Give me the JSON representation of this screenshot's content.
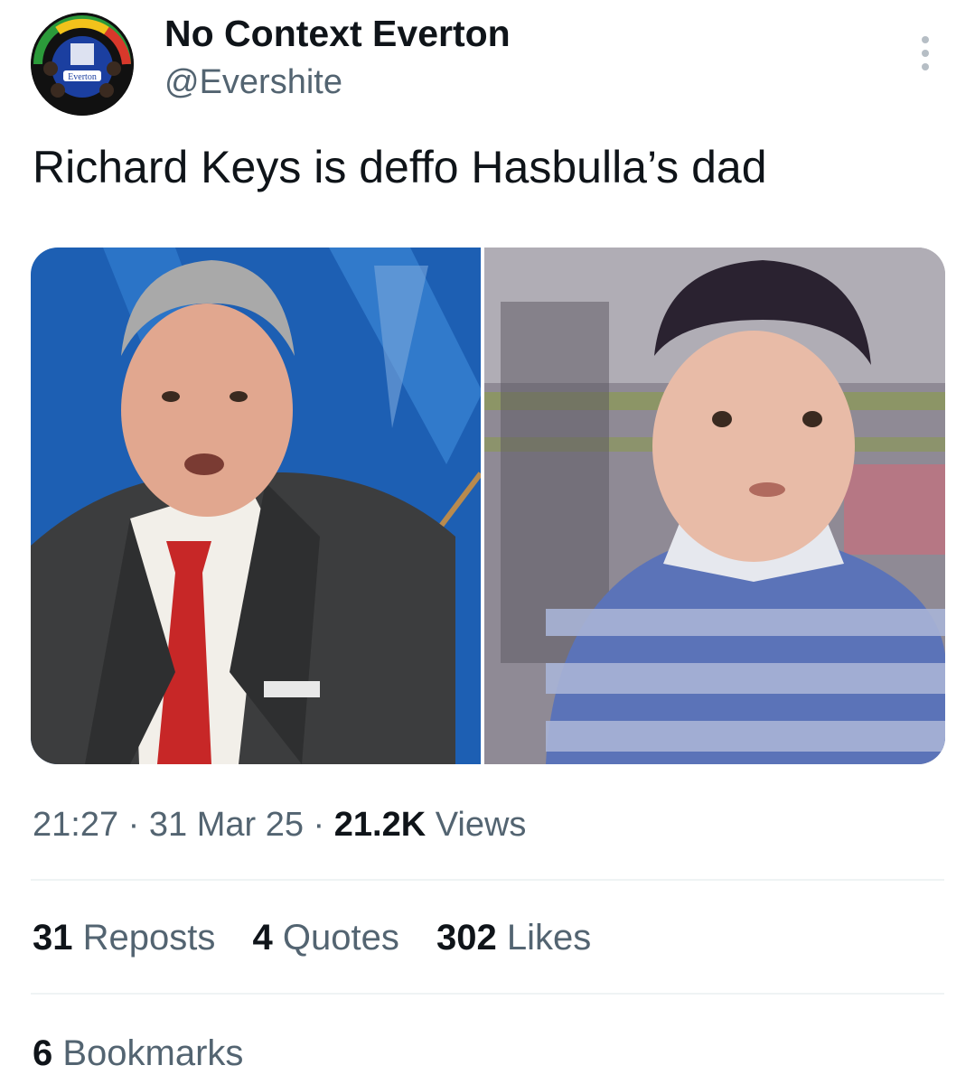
{
  "author": {
    "display_name": "No Context Everton",
    "handle": "@Evershite",
    "avatar_icon": "everton-crest-avatar",
    "avatar_crest_text": "Everton"
  },
  "tweet": {
    "text": "Richard Keys is deffo Hasbulla’s dad",
    "media": [
      {
        "icon": "photo-man-in-suit"
      },
      {
        "icon": "photo-child-striped-shirt"
      }
    ]
  },
  "meta": {
    "time": "21:27",
    "separator": "·",
    "date": "31 Mar 25",
    "views_count": "21.2K",
    "views_label": "Views"
  },
  "engagement": {
    "reposts_count": "31",
    "reposts_label": "Reposts",
    "quotes_count": "4",
    "quotes_label": "Quotes",
    "likes_count": "302",
    "likes_label": "Likes",
    "bookmarks_count": "6",
    "bookmarks_label": "Bookmarks"
  },
  "colors": {
    "text_primary": "#0f1419",
    "text_secondary": "#536471",
    "divider": "#eff3f4"
  }
}
